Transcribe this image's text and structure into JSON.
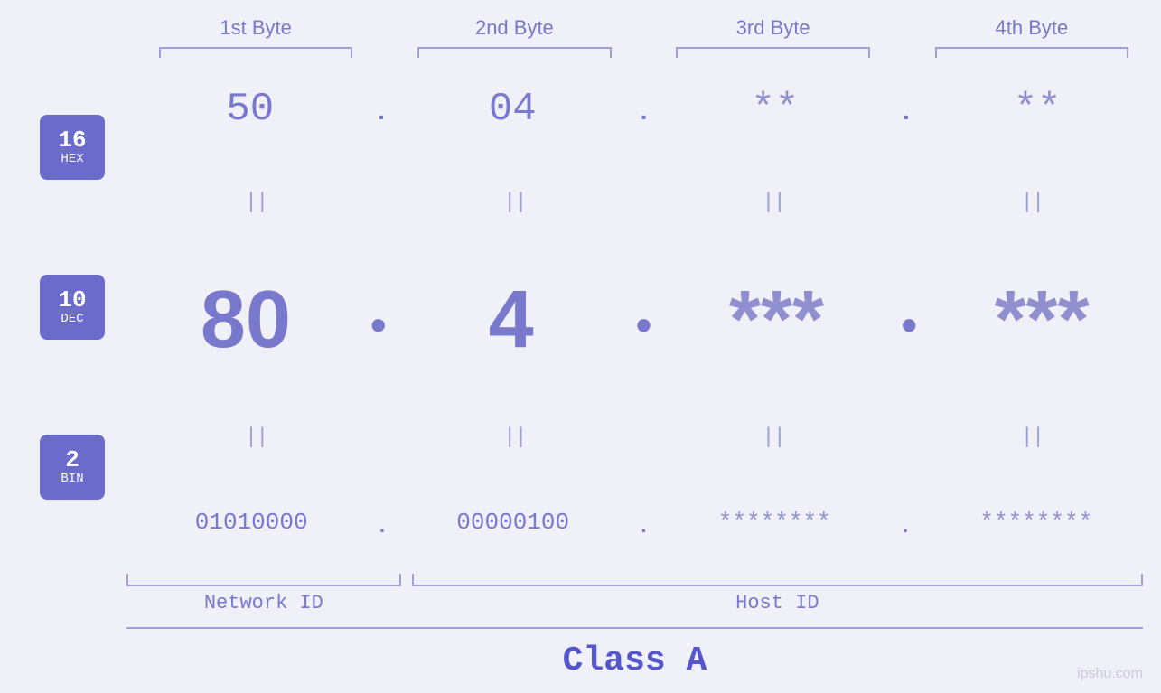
{
  "header": {
    "bytes": [
      {
        "label": "1st Byte"
      },
      {
        "label": "2nd Byte"
      },
      {
        "label": "3rd Byte"
      },
      {
        "label": "4th Byte"
      }
    ]
  },
  "badges": [
    {
      "number": "16",
      "label": "HEX"
    },
    {
      "number": "10",
      "label": "DEC"
    },
    {
      "number": "2",
      "label": "BIN"
    }
  ],
  "rows": {
    "hex": {
      "values": [
        "50",
        "04",
        "**",
        "**"
      ],
      "dots": [
        ".",
        ".",
        ".",
        ""
      ]
    },
    "dec": {
      "values": [
        "80",
        "4",
        "***",
        "***"
      ],
      "dots": [
        ".",
        ".",
        ".",
        ""
      ]
    },
    "bin": {
      "values": [
        "01010000",
        "00000100",
        "********",
        "********"
      ],
      "dots": [
        ".",
        ".",
        ".",
        ""
      ]
    }
  },
  "labels": {
    "network_id": "Network ID",
    "host_id": "Host ID",
    "class": "Class A"
  },
  "watermark": "ipshu.com",
  "separator": "||"
}
